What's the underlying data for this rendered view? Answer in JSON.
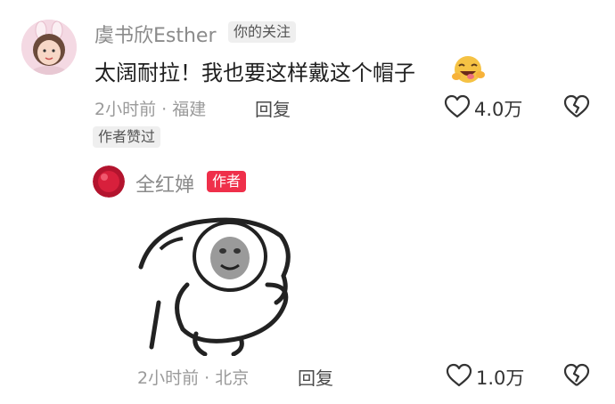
{
  "comment1": {
    "username": "虞书欣Esther",
    "follow_tag": "你的关注",
    "text": "太阔耐拉！我也要这样戴这个帽子",
    "time": "2小时前",
    "location": "福建",
    "reply_label": "回复",
    "like_count": "4.0万",
    "author_liked_tag": "作者赞过",
    "emoji": "grinning-tongue-emoji"
  },
  "comment2": {
    "username": "全红婵",
    "author_tag": "作者",
    "sticker": "panda-man-meme-sticker",
    "time": "2小时前",
    "location": "北京",
    "reply_label": "回复",
    "like_count": "1.0万"
  },
  "colors": {
    "author_tag": "#ef2f4a",
    "meta_text": "#9a9a9a",
    "username": "#8b8b8b"
  }
}
